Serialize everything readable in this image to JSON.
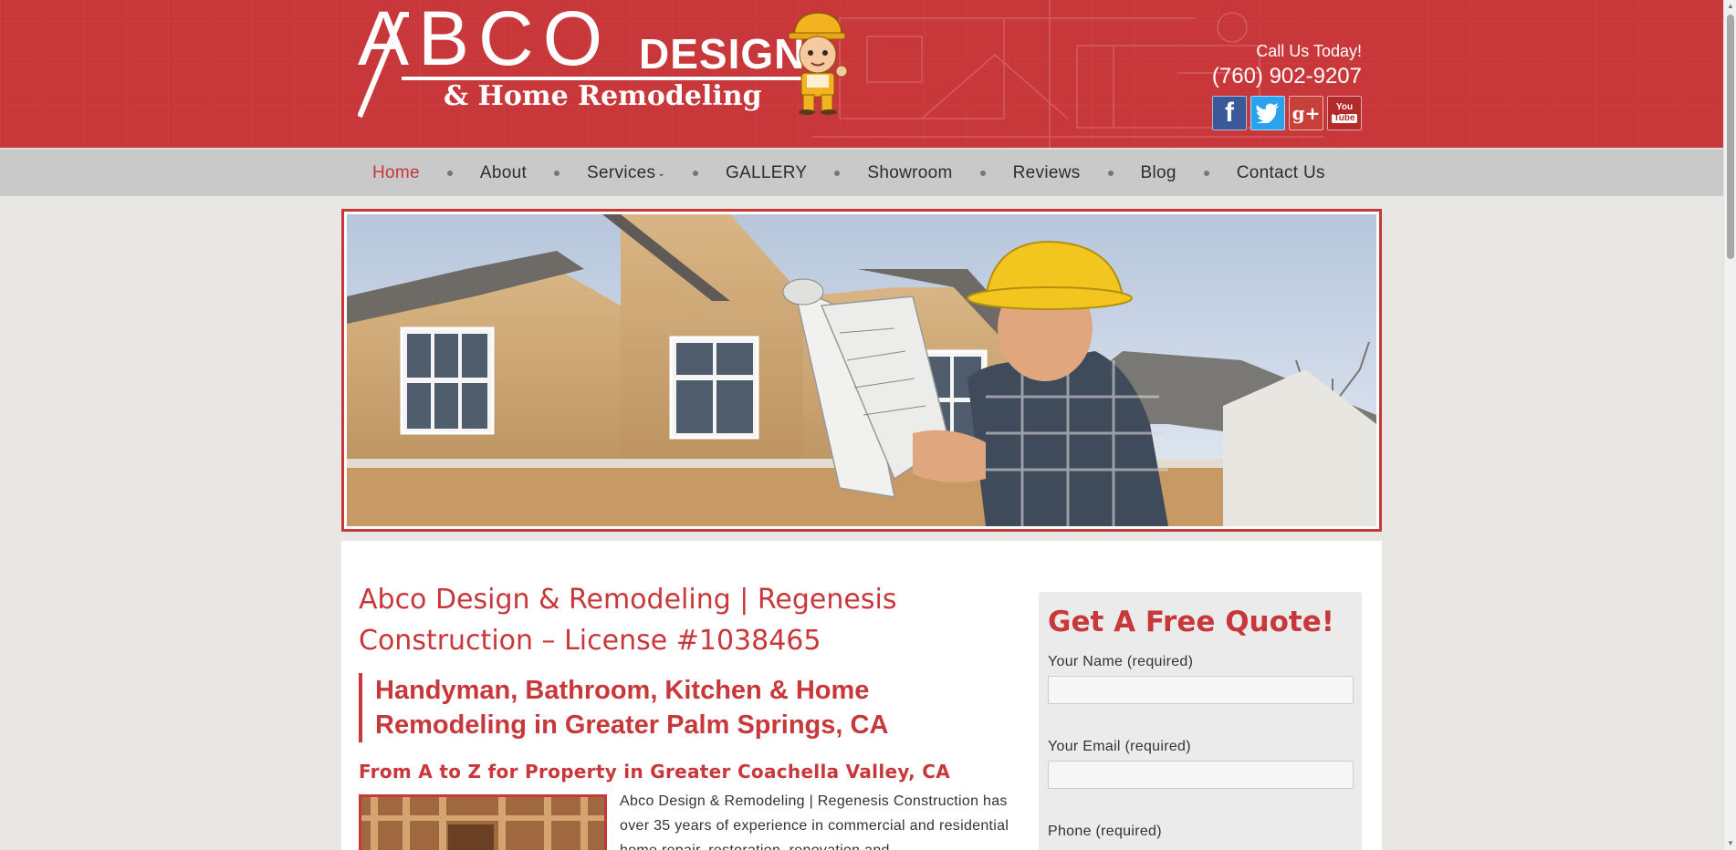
{
  "header": {
    "logo": {
      "abco": "ABCO",
      "design": "DESIGN",
      "subtitle": "& Home Remodeling"
    },
    "call_label": "Call Us Today!",
    "phone": "(760) 902-9207",
    "socials": [
      {
        "name": "facebook",
        "glyph": "f"
      },
      {
        "name": "twitter",
        "glyph": "t"
      },
      {
        "name": "google-plus",
        "glyph": "g+"
      },
      {
        "name": "youtube",
        "line1": "You",
        "line2": "Tube"
      }
    ],
    "brand_color": "#c8373a"
  },
  "nav": {
    "items": [
      {
        "label": "Home",
        "active": true
      },
      {
        "label": "About"
      },
      {
        "label": "Services",
        "has_dropdown": true
      },
      {
        "label": "GALLERY"
      },
      {
        "label": "Showroom"
      },
      {
        "label": "Reviews"
      },
      {
        "label": "Blog"
      },
      {
        "label": "Contact Us"
      }
    ]
  },
  "main": {
    "title": "Abco Design & Remodeling | Regenesis Construction – License #1038465",
    "subheading": "Handyman, Bathroom, Kitchen & Home Remodeling in Greater Palm Springs, CA",
    "tagline": "From A to Z for Property in Greater Coachella Valley, CA",
    "body": "Abco Design & Remodeling | Regenesis Construction has over 35 years of experience in commercial and residential home repair, restoration, renovation and"
  },
  "quote_form": {
    "title": "Get A Free Quote!",
    "fields": [
      {
        "label": "Your Name (required)",
        "value": ""
      },
      {
        "label": "Your Email (required)",
        "value": ""
      },
      {
        "label": "Phone (required)",
        "value": ""
      }
    ]
  }
}
